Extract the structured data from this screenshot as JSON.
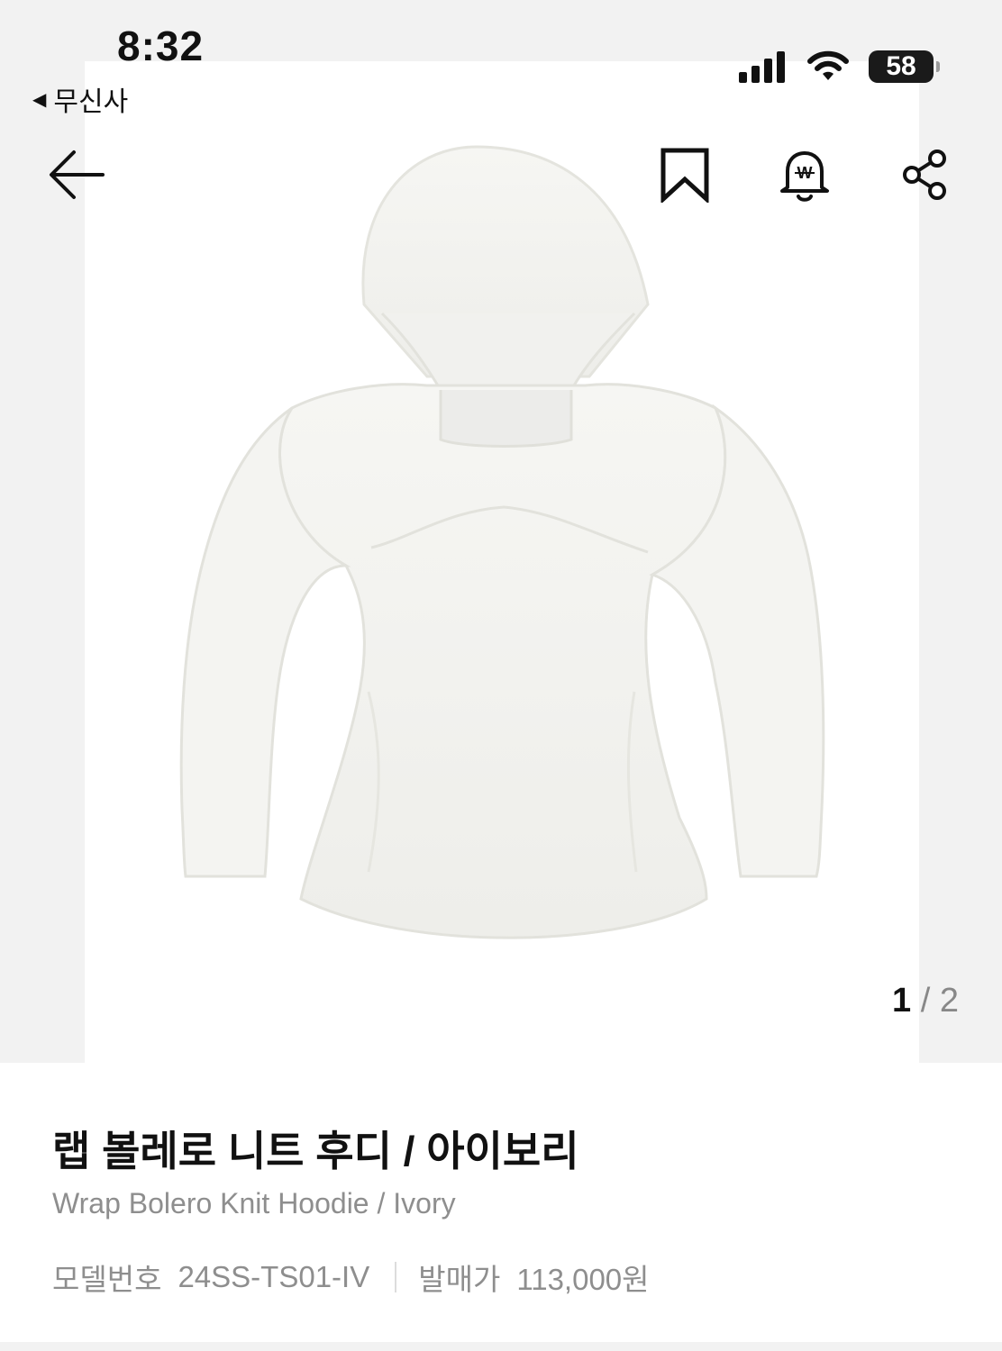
{
  "status_bar": {
    "time": "8:32",
    "back_app_label": "무신사",
    "battery": "58"
  },
  "gallery": {
    "current": "1",
    "separator": "/",
    "total": "2"
  },
  "product": {
    "title": "랩 볼레로 니트 후디 / 아이보리",
    "subtitle": "Wrap Bolero Knit Hoodie / Ivory",
    "model_label": "모델번호",
    "model_value": "24SS-TS01-IV",
    "price_label": "발매가",
    "price_value": "113,000원"
  },
  "icons": {
    "back": "arrow-left-icon",
    "bookmark": "bookmark-icon",
    "price_alert": "price-alert-bell-icon",
    "share": "share-icon"
  }
}
